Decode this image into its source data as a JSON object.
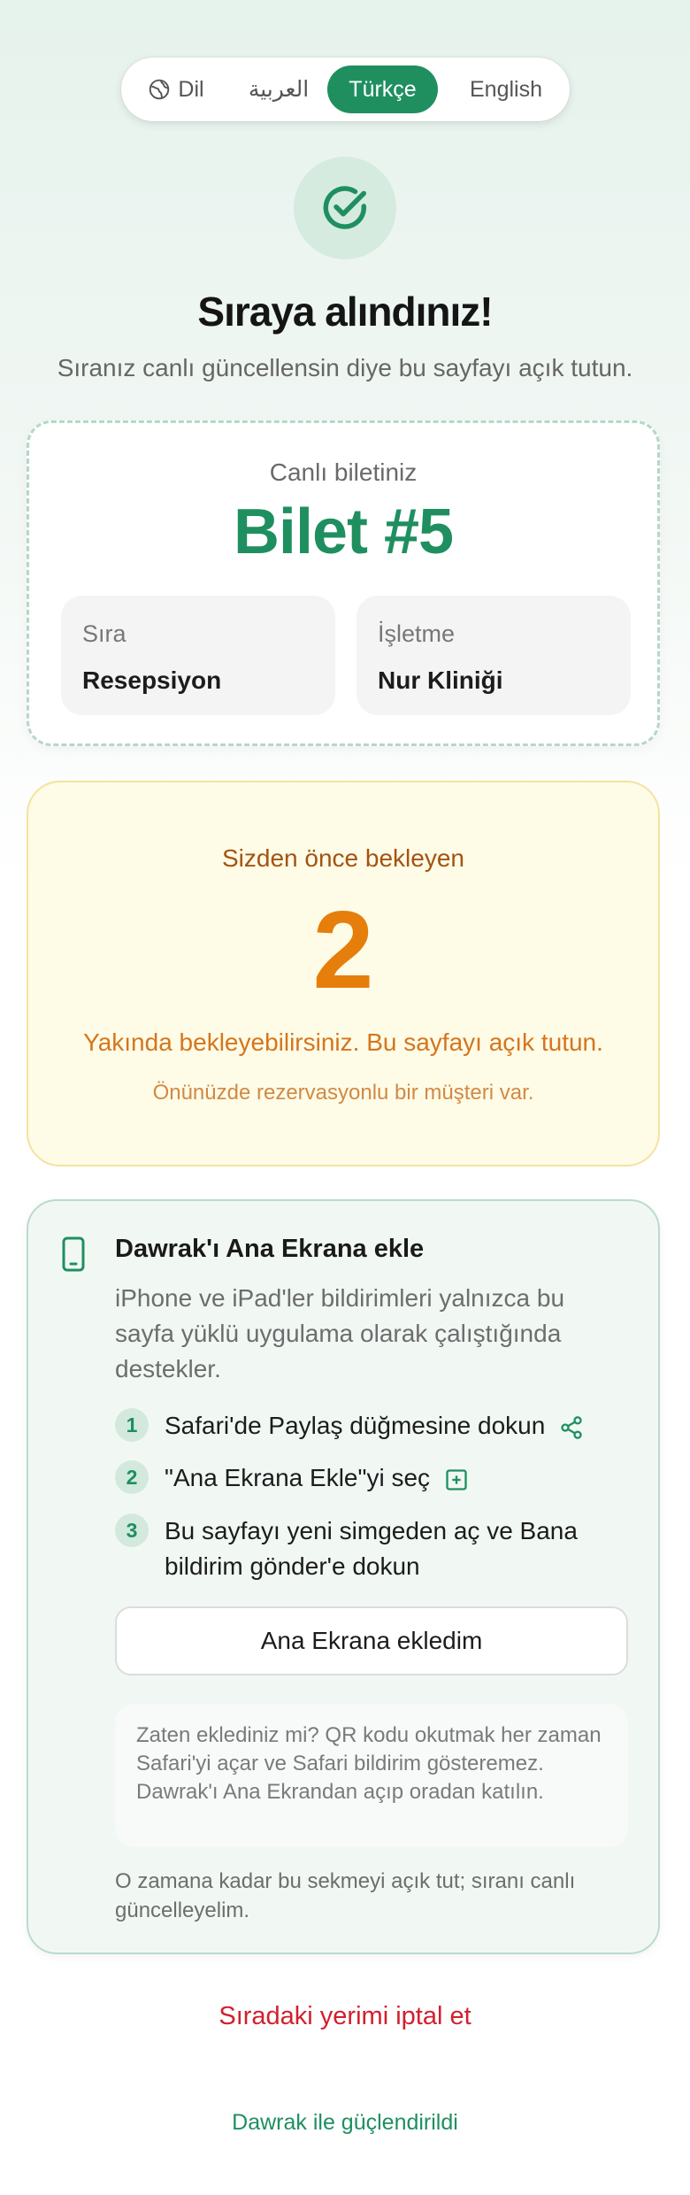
{
  "language_bar": {
    "language_label": "Dil",
    "options": [
      "العربية",
      "Türkçe",
      "English"
    ],
    "selected": "Türkçe"
  },
  "header": {
    "title": "Sıraya alındınız!",
    "subtitle": "Sıranız canlı güncellensin diye bu sayfayı açık tutun."
  },
  "ticket": {
    "label": "Canlı biletiniz",
    "number": "Bilet #5",
    "queue_label": "Sıra",
    "queue_value": "Resepsiyon",
    "business_label": "İşletme",
    "business_value": "Nur Kliniği"
  },
  "waiting": {
    "label": "Sizden önce bekleyen",
    "count": "2",
    "message": "Yakında bekleyebilirsiniz. Bu sayfayı açık tutun.",
    "note": "Önünüzde rezervasyonlu bir müşteri var."
  },
  "install": {
    "title": "Dawrak'ı Ana Ekrana ekle",
    "description": "iPhone ve iPad'ler bildirimleri yalnızca bu sayfa yüklü uygulama olarak çalıştığında destekler.",
    "steps": [
      {
        "number": "1",
        "text": "Safari'de Paylaş düğmesine dokun"
      },
      {
        "number": "2",
        "text": "\"Ana Ekrana Ekle\"yi seç"
      },
      {
        "number": "3",
        "text": "Bu sayfayı yeni simgeden aç ve Bana bildirim gönder'e dokun"
      }
    ],
    "button_label": "Ana Ekrana ekledim",
    "hint": "Zaten eklediniz mi? QR kodu okutmak her zaman Safari'yi açar ve Safari bildirim gösteremez. Dawrak'ı Ana Ekrandan açıp oradan katılın.",
    "keep_open": "O zamana kadar bu sekmeyi açık tut; sıranı canlı güncelleyelim."
  },
  "cancel_label": "Sıradaki yerimi iptal et",
  "footer": "Dawrak ile güçlendirildi",
  "colors": {
    "brand_green": "#1f8f60",
    "wait_orange": "#e67e0b",
    "cancel_red": "#d21f2c"
  },
  "icons": [
    "globe-icon",
    "check-icon",
    "phone-icon",
    "share-icon",
    "add-square-icon"
  ]
}
